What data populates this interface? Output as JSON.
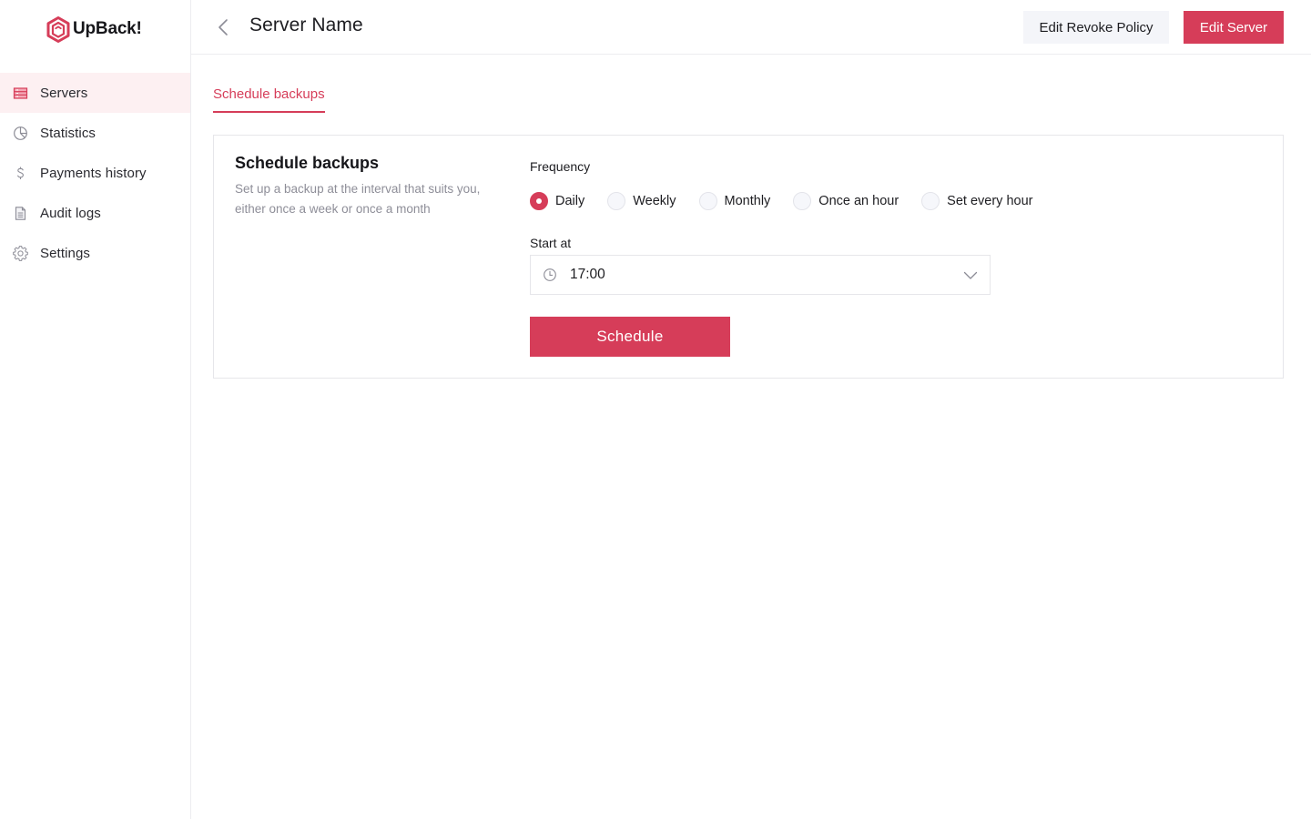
{
  "app": {
    "name": "UpBack!",
    "brand_color": "#d63d59"
  },
  "sidebar": {
    "items": [
      {
        "label": "Servers",
        "icon": "server-icon",
        "active": true
      },
      {
        "label": "Statistics",
        "icon": "pie-chart-icon",
        "active": false
      },
      {
        "label": "Payments history",
        "icon": "dollar-icon",
        "active": false
      },
      {
        "label": "Audit logs",
        "icon": "document-icon",
        "active": false
      },
      {
        "label": "Settings",
        "icon": "gear-icon",
        "active": false
      }
    ]
  },
  "header": {
    "back_icon": "chevron-left-icon",
    "title": "Server Name",
    "edit_revoke_policy_label": "Edit Revoke Policy",
    "edit_server_label": "Edit Server"
  },
  "tabs": [
    {
      "label": "Schedule backups",
      "active": true
    }
  ],
  "schedule_card": {
    "title": "Schedule backups",
    "description": "Set up a backup at the interval that suits you, either once a week or once a month",
    "frequency_label": "Frequency",
    "frequency_options": [
      {
        "label": "Daily",
        "checked": true
      },
      {
        "label": "Weekly",
        "checked": false
      },
      {
        "label": "Monthly",
        "checked": false
      },
      {
        "label": "Once an hour",
        "checked": false
      },
      {
        "label": "Set every hour",
        "checked": false
      }
    ],
    "start_at_label": "Start at",
    "start_at_value": "17:00",
    "schedule_button_label": "Schedule"
  }
}
